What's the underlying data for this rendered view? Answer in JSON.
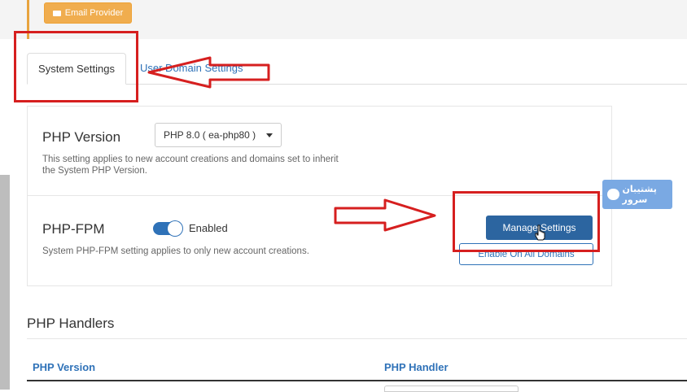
{
  "header": {
    "email_provider_label": "Email Provider"
  },
  "tabs": [
    {
      "label": "System Settings",
      "active": true
    },
    {
      "label": "User Domain Settings",
      "active": false
    }
  ],
  "php_version": {
    "label": "PHP Version",
    "selected": "PHP 8.0 ( ea-php80 )",
    "help": "This setting applies to new account creations and domains set to inherit the System PHP Version."
  },
  "php_fpm": {
    "label": "PHP-FPM",
    "toggle_state": "Enabled",
    "help": "System PHP-FPM setting applies to only new account creations.",
    "manage_button": "Manage Settings",
    "enable_all_button": "Enable On All Domains"
  },
  "handlers": {
    "title": "PHP Handlers",
    "columns": [
      "PHP Version",
      "PHP Handler"
    ]
  },
  "watermark": {
    "text": "پشتیبان سرور"
  },
  "colors": {
    "accent_blue": "#2f72b8",
    "primary_button": "#2c65a0",
    "warning_orange": "#f0ad4e",
    "annotation_red": "#d61f1f"
  },
  "icons": [
    "envelope-icon",
    "caret-down-icon",
    "cursor-hand-icon",
    "cloud-icon"
  ]
}
